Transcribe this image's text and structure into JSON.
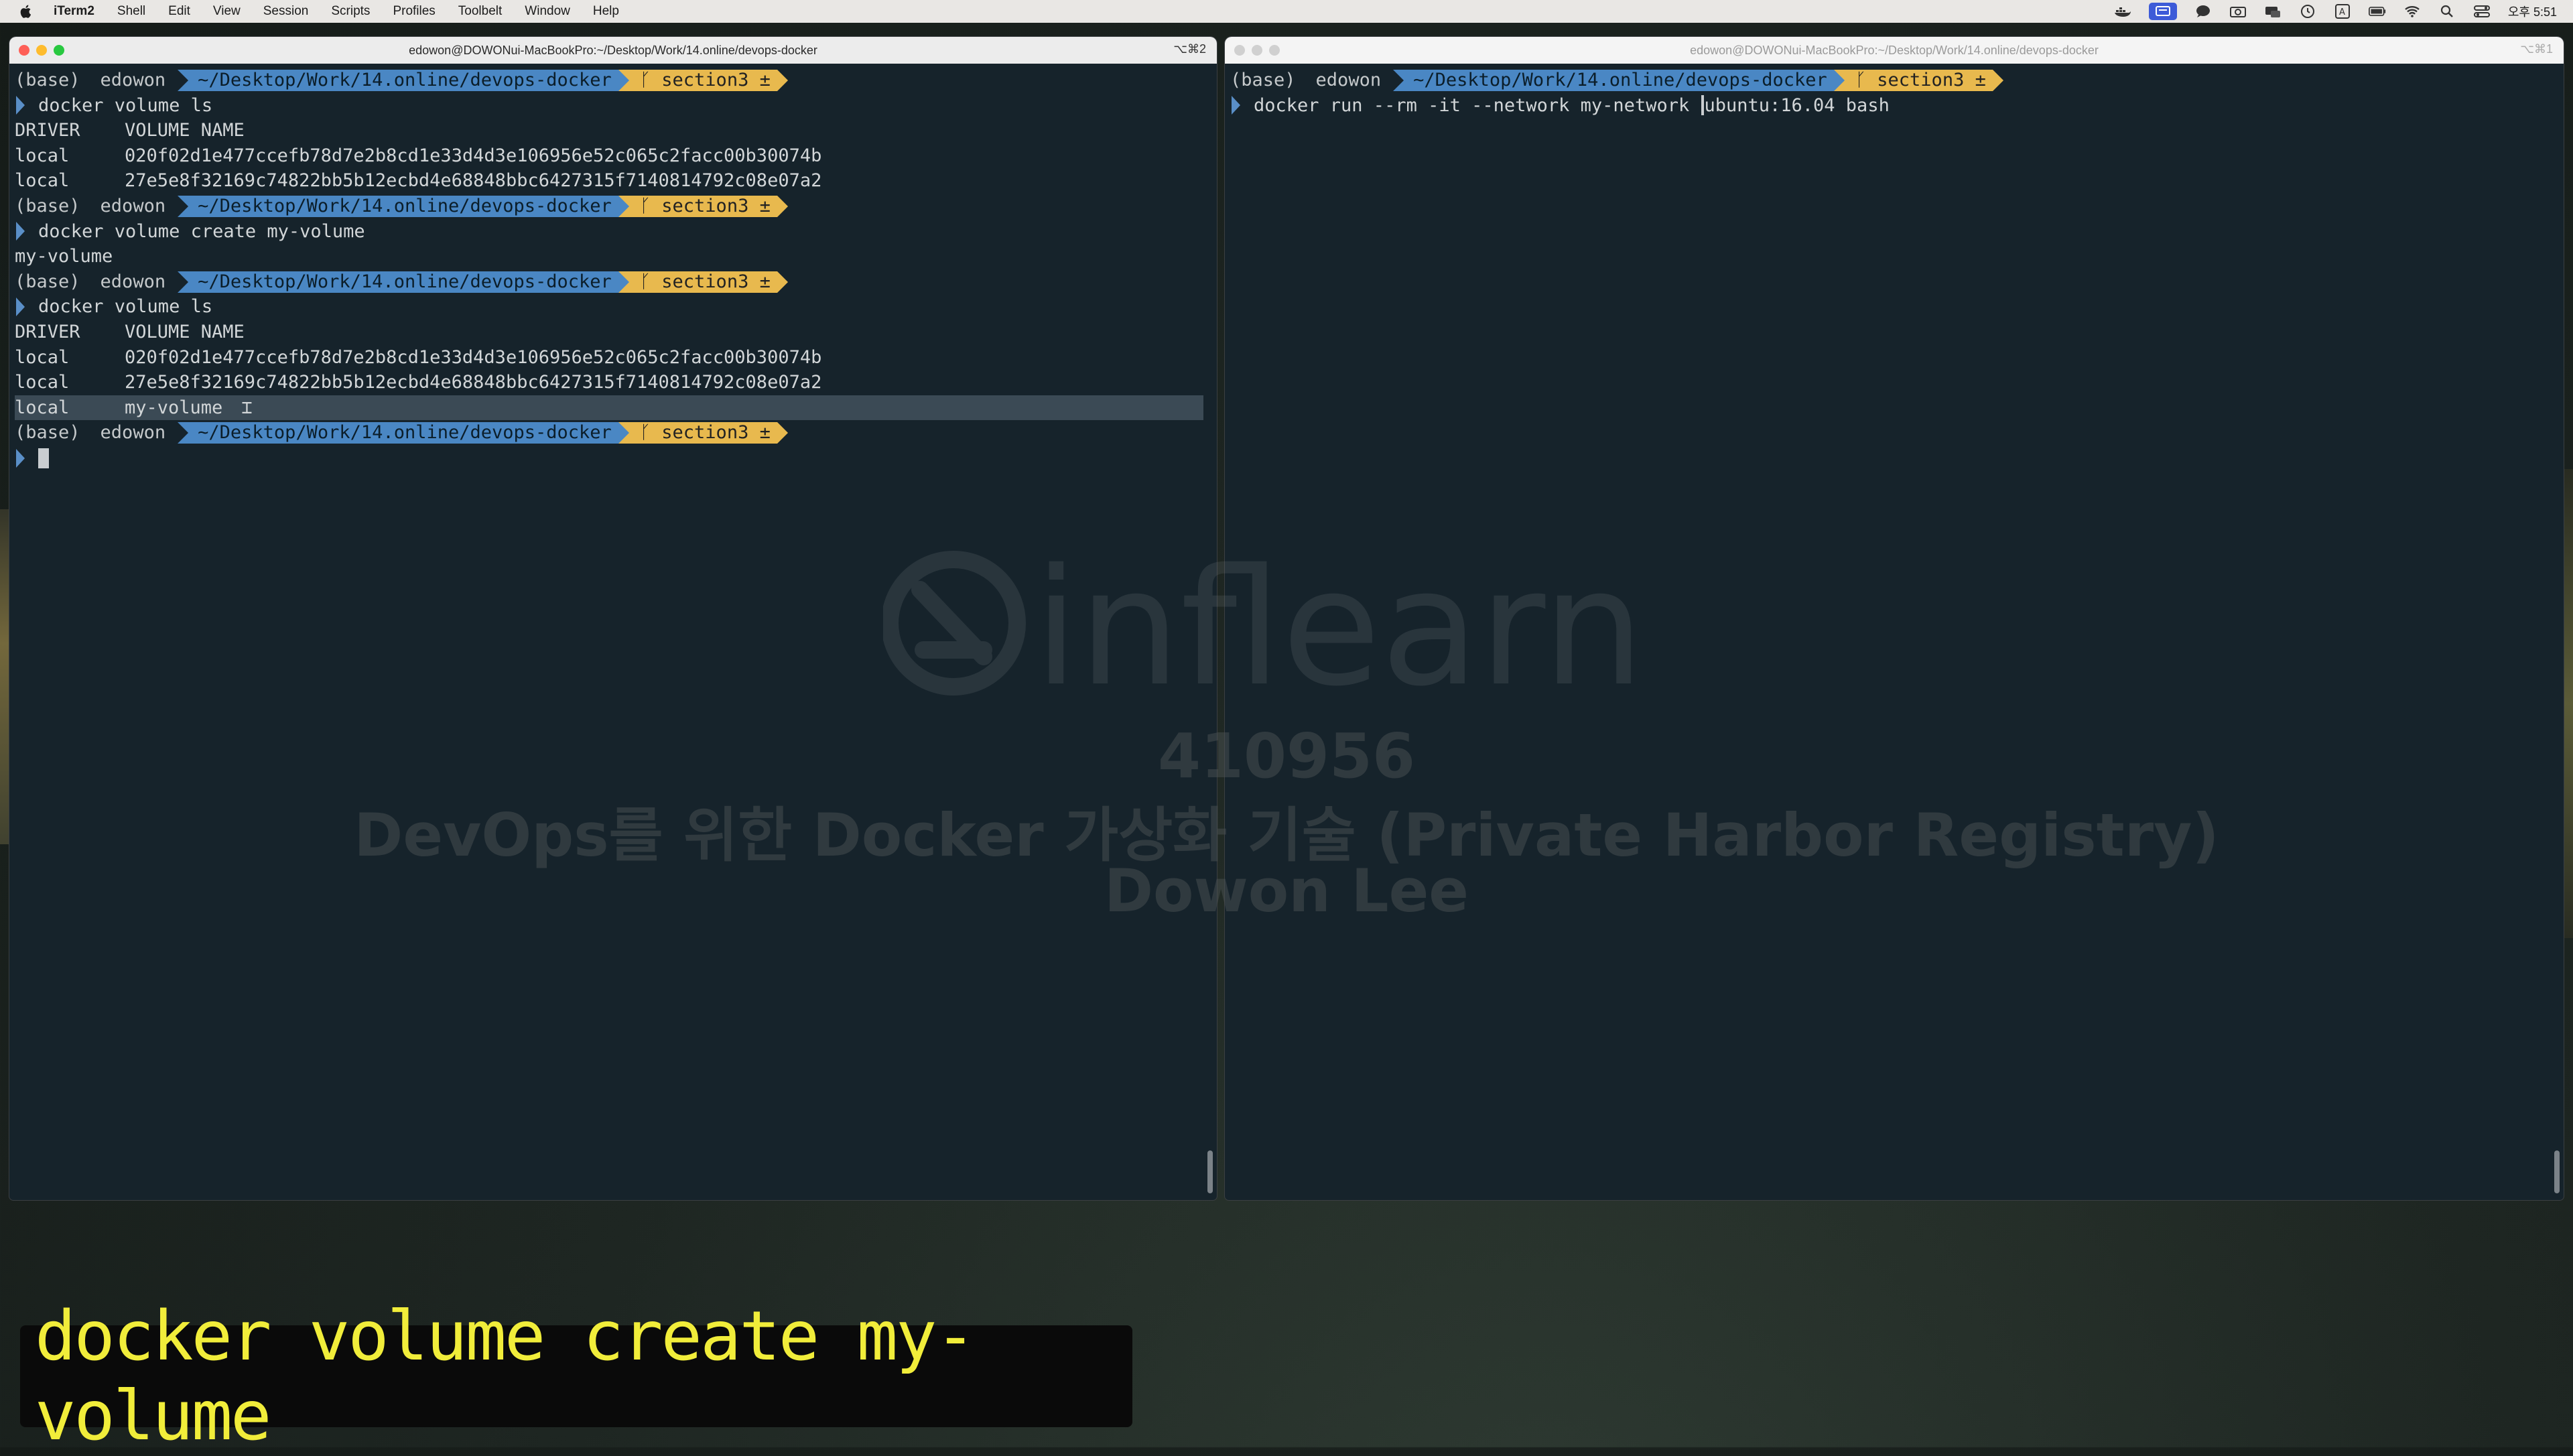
{
  "menubar": {
    "app_name": "iTerm2",
    "items": [
      "Shell",
      "Edit",
      "View",
      "Session",
      "Scripts",
      "Profiles",
      "Toolbelt",
      "Window",
      "Help"
    ],
    "clock": "오후 5:51"
  },
  "left_window": {
    "title": "edowon@DOWONui-MacBookPro:~/Desktop/Work/14.online/devops-docker",
    "shortcut": "⌥⌘2",
    "prompt": {
      "env": "(base)",
      "user": "edowon",
      "path": "~/Desktop/Work/14.online/devops-docker",
      "branch": "section3 ±"
    },
    "commands": {
      "ls1": "docker volume ls",
      "create": "docker volume create my-volume",
      "ls2": "docker volume ls"
    },
    "output": {
      "header_driver": "DRIVER",
      "header_name": "VOLUME NAME",
      "driver": "local",
      "vol1": "020f02d1e477ccefb78d7e2b8cd1e33d4d3e106956e52c065c2facc00b30074b",
      "vol2": "27e5e8f32169c74822bb5b12ecbd4e68848bbc6427315f7140814792c08e07a2",
      "create_result": "my-volume",
      "vol3": "my-volume"
    }
  },
  "right_window": {
    "title": "edowon@DOWONui-MacBookPro:~/Desktop/Work/14.online/devops-docker",
    "shortcut": "⌥⌘1",
    "prompt": {
      "env": "(base)",
      "user": "edowon",
      "path": "~/Desktop/Work/14.online/devops-docker",
      "branch": "section3 ±"
    },
    "command_before_cursor": "docker run --rm -it --network my-network ",
    "command_after_cursor": "ubuntu:16.04 bash"
  },
  "watermark": {
    "brand": "inflearn",
    "id": "410956",
    "course": "DevOps를 위한 Docker 가상화 기술 (Private Harbor Registry)",
    "author": "Dowon Lee"
  },
  "caption": {
    "text": "docker volume create my-volume"
  },
  "colors": {
    "terminal_bg": "#16232b",
    "path_segment": "#4a87c4",
    "git_segment": "#e8b94e",
    "caption_text": "#f1ed3a"
  }
}
